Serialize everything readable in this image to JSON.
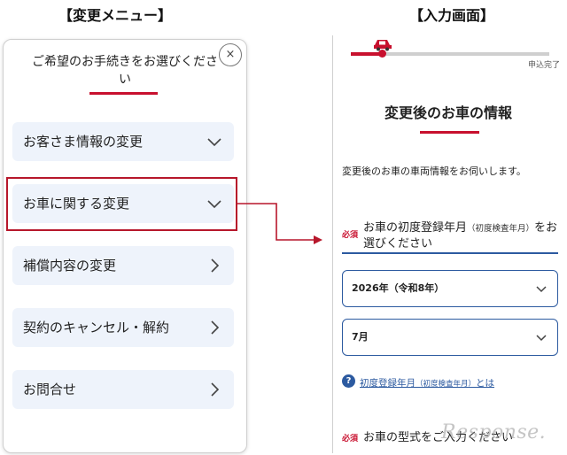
{
  "captions": {
    "left": "【変更メニュー】",
    "right": "【入力画面】"
  },
  "menu": {
    "title": "ご希望のお手続きをお選びください",
    "close_icon": "×",
    "items": [
      {
        "label": "お客さま情報の変更",
        "icon": "chevron-down-icon"
      },
      {
        "label": "お車に関する変更",
        "icon": "chevron-down-icon"
      },
      {
        "label": "補償内容の変更",
        "icon": "chevron-right-icon"
      },
      {
        "label": "契約のキャンセル・解約",
        "icon": "chevron-right-icon"
      },
      {
        "label": "お問合せ",
        "icon": "chevron-right-icon"
      }
    ],
    "highlighted_index": 1
  },
  "form": {
    "progress": {
      "end_label": "申込完了",
      "fraction": 0.15
    },
    "heading": "変更後のお車の情報",
    "intro": "変更後のお車の車両情報をお伺いします。",
    "q1": {
      "required": "必須",
      "label_main": "お車の初度登録年月",
      "label_sub": "（初度検査年月）",
      "label_tail": "をお選びください"
    },
    "year_select": {
      "value": "2026年（令和8年）"
    },
    "month_select": {
      "value": "7月"
    },
    "help": {
      "icon": "?",
      "link_main": "初度登録年月",
      "link_sub": "（初度検査年月）",
      "link_tail": "とは"
    },
    "q2": {
      "required": "必須",
      "label": "お車の型式をご入力ください"
    }
  },
  "watermark": "Response.",
  "colors": {
    "accent_red": "#c8102e",
    "link_blue": "#2c5aa0",
    "menu_item_bg": "#eef3fb"
  }
}
